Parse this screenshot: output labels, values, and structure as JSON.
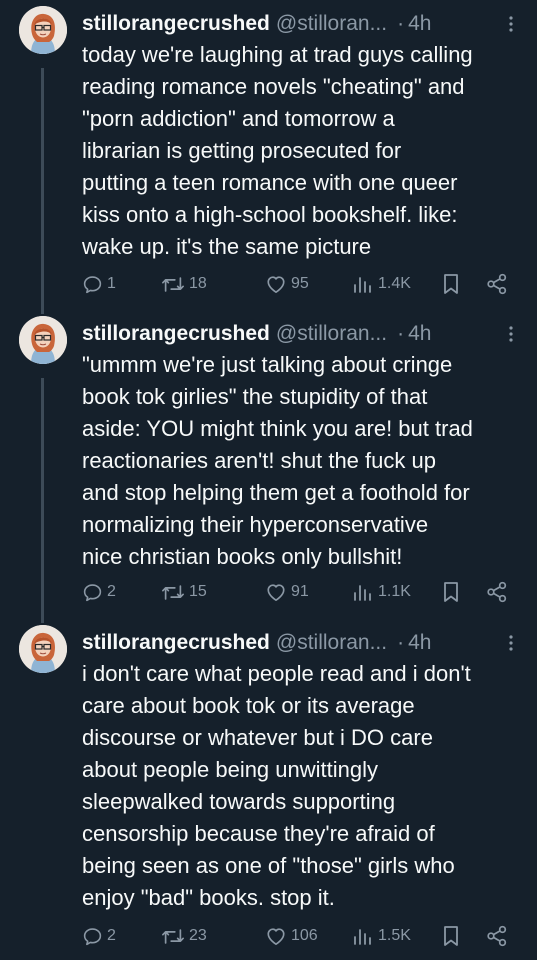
{
  "tweets": [
    {
      "display_name": "stillorangecrushed",
      "handle": "@stilloran...",
      "separator": "·",
      "time": "4h",
      "text": "today we're laughing at trad guys calling\nreading romance novels \"cheating\" and\n\"porn addiction\" and tomorrow a\nlibrarian is getting prosecuted for\nputting a teen romance with one queer\nkiss onto a high-school bookshelf. like:\nwake up. it's the same picture",
      "replies": "1",
      "reposts": "18",
      "likes": "95",
      "views": "1.4K"
    },
    {
      "display_name": "stillorangecrushed",
      "handle": "@stilloran...",
      "separator": "·",
      "time": "4h",
      "text": "\"ummm we're just talking about cringe\nbook tok girlies\" the stupidity of that\naside: YOU might think you are! but trad\nreactionaries aren't! shut the fuck up\nand stop helping them get a foothold for\nnormalizing their hyperconservative\nnice christian books only bullshit!",
      "replies": "2",
      "reposts": "15",
      "likes": "91",
      "views": "1.1K"
    },
    {
      "display_name": "stillorangecrushed",
      "handle": "@stilloran...",
      "separator": "·",
      "time": "4h",
      "text": "i don't care what people read and i don't\ncare about book tok or its average\ndiscourse or whatever but i DO care\nabout people being unwittingly\nsleepwalked towards supporting\ncensorship because they're afraid of\nbeing seen as one of \"those\" girls who\nenjoy \"bad\" books. stop it.",
      "replies": "2",
      "reposts": "23",
      "likes": "106",
      "views": "1.5K"
    }
  ],
  "colors": {
    "background": "#15202b",
    "text": "#f7f9f9",
    "secondary": "#8b98a5",
    "thread_line": "#3d4b58"
  },
  "icons": {
    "reply": "speech-bubble-icon",
    "repost": "retweet-arrows-icon",
    "like": "heart-icon",
    "views": "bar-chart-icon",
    "bookmark": "bookmark-icon",
    "share": "share-nodes-icon",
    "more": "vertical-dots-icon"
  }
}
